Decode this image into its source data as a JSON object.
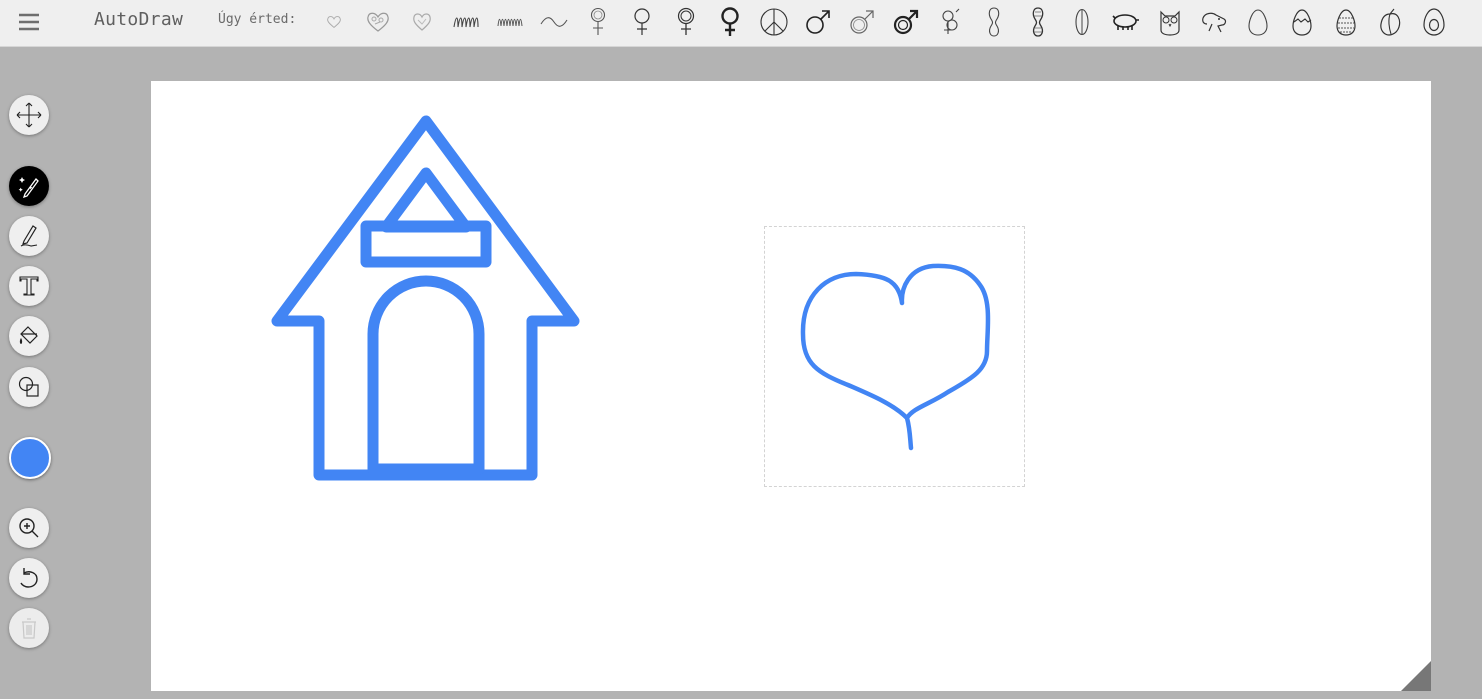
{
  "app": {
    "title": "AutoDraw",
    "menu_icon": "hamburger-menu-icon"
  },
  "suggestions": {
    "label": "Úgy érted:",
    "items": [
      "heart-outline-icon",
      "heart-doodle-icon",
      "heart-sketch-icon",
      "coil-spring-icon",
      "zigzag-spring-icon",
      "wave-line-icon",
      "venus-cross-icon",
      "venus-icon",
      "venus-ring-icon",
      "venus-bold-icon",
      "peace-sign-icon",
      "mars-icon",
      "mars-outline-icon",
      "mars-bold-icon",
      "intertwined-symbol-icon",
      "peanut-icon",
      "peanut-shell-icon",
      "seed-icon",
      "pig-icon",
      "owl-icon",
      "dog-icon",
      "egg-icon",
      "hatching-egg-icon",
      "easter-egg-icon",
      "peach-icon",
      "avocado-icon"
    ]
  },
  "toolbar": {
    "tools": [
      {
        "name": "move-tool",
        "icon": "move-arrows-icon",
        "active": false
      },
      {
        "name": "autodraw-tool",
        "icon": "magic-pencil-icon",
        "active": true
      },
      {
        "name": "draw-tool",
        "icon": "pencil-icon",
        "active": false
      },
      {
        "name": "type-tool",
        "icon": "text-t-icon",
        "active": false
      },
      {
        "name": "fill-tool",
        "icon": "paint-bucket-icon",
        "active": false
      },
      {
        "name": "shape-tool",
        "icon": "shapes-icon",
        "active": false
      }
    ],
    "color": "#4285f4",
    "actions": [
      {
        "name": "zoom-button",
        "icon": "zoom-in-icon"
      },
      {
        "name": "undo-button",
        "icon": "undo-icon"
      },
      {
        "name": "delete-button",
        "icon": "trash-icon",
        "disabled": true
      }
    ]
  },
  "canvas": {
    "stroke_color": "#4285f4",
    "objects": [
      "doghouse-drawing",
      "heart-doodle-drawing"
    ],
    "selected": "heart-doodle-drawing"
  }
}
